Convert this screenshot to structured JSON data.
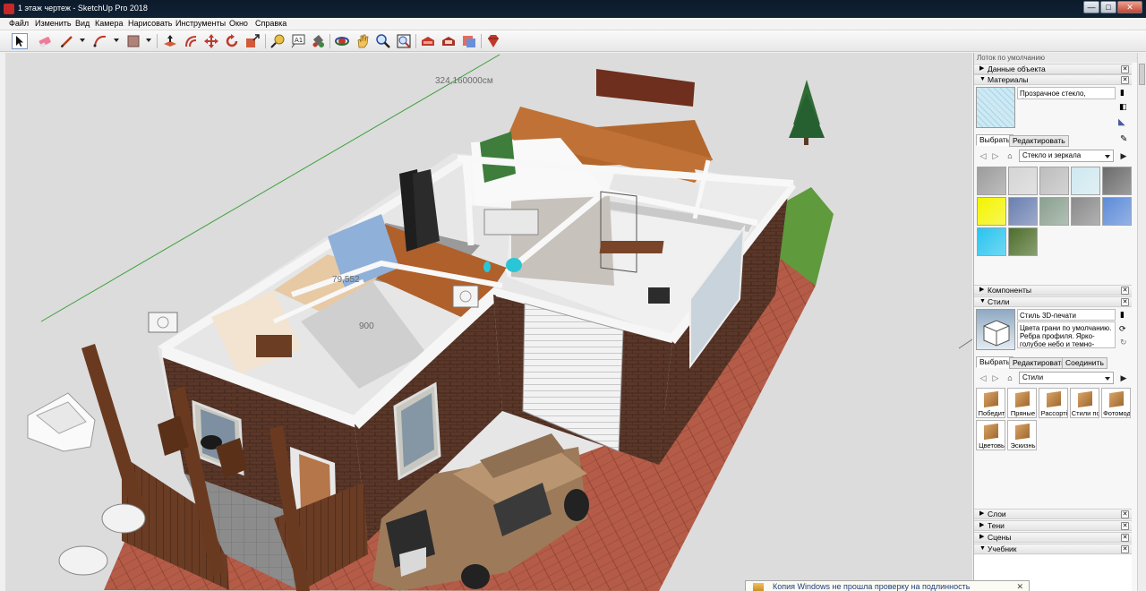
{
  "window": {
    "title": "1 этаж чертеж - SketchUp Pro 2018",
    "min": "—",
    "max": "□",
    "close": "✕"
  },
  "menu": [
    "Файл",
    "Изменить",
    "Вид",
    "Камера",
    "Нарисовать",
    "Инструменты",
    "Окно",
    "Справка"
  ],
  "toolbar": {
    "tools": [
      "select-icon",
      "eraser-icon",
      "pencil-icon",
      "arc-icon",
      "rectangle-icon",
      "push-pull-icon",
      "offset-icon",
      "move-icon",
      "rotate-icon",
      "scale-icon",
      "tape-measure-icon",
      "text-icon",
      "paint-bucket-icon",
      "orbit-icon",
      "pan-icon",
      "zoom-icon",
      "zoom-extents-icon",
      "warehouse-icon",
      "extension-warehouse-icon",
      "send-to-layout-icon",
      "ruby-icon"
    ]
  },
  "viewport": {
    "dimensions": [
      "324,160000см",
      "79,552",
      "900"
    ]
  },
  "tray": {
    "title": "Лоток по умолчанию",
    "pin": "⊣",
    "panels": {
      "entity_info": "Данные объекта",
      "materials": "Материалы",
      "components": "Компоненты",
      "styles": "Стили",
      "layers": "Слои",
      "shadows": "Тени",
      "scenes": "Сцены",
      "tutorial": "Учебник"
    },
    "material": {
      "name": "Прозрачное стекло, безопасное",
      "tab_select": "Выбрать",
      "tab_edit": "Редактировать",
      "collection": "Стекло и зеркала",
      "swatch_colors": [
        "#9c9c9c",
        "#d4d4d4",
        "#bdbdbd",
        "#cfe8f0",
        "#6b6b6b",
        "#f4f400",
        "#6a7fb0",
        "#8aa090",
        "#8a8a8a",
        "#5d8bd8",
        "#29c4ee",
        "#4e6e2c"
      ]
    },
    "style": {
      "name": "Стиль 3D-печати",
      "description": "Цвета грани по умолчанию. Ребра профиля. Ярко-голубое небо и темно-серый",
      "tab_select": "Выбрать",
      "tab_edit": "Редактировать",
      "tab_mix": "Соединить",
      "collection": "Стили",
      "items": [
        "Победит",
        "Пряные",
        "Рассортi",
        "Стили пс",
        "Фотомод",
        "Цветовь",
        "Эскизнь"
      ]
    }
  },
  "notification": {
    "text": "Копия Windows не прошла проверку на подлинность",
    "close": "✕"
  },
  "colors": {
    "titlebar": "#0f2236",
    "tray_bg": "#f7f7f7",
    "paving": "#b5604a",
    "brick": "#5e3a2c",
    "sky_bg": "#dcdcdc"
  }
}
